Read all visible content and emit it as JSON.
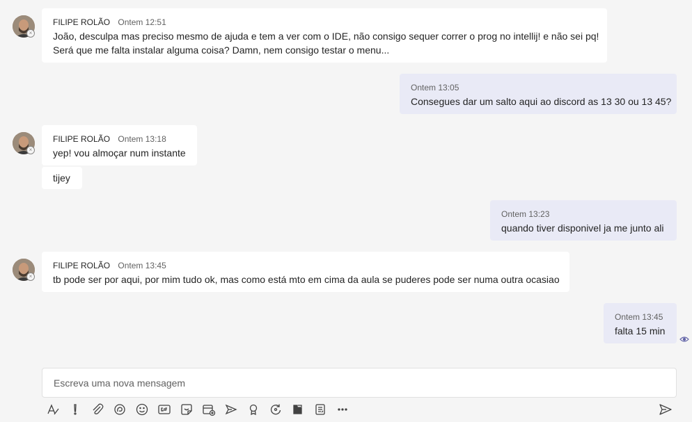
{
  "messages": [
    {
      "direction": "in",
      "sender": "FILIPE ROLÃO",
      "time": "Ontem 12:51",
      "lines": [
        "João, desculpa mas preciso mesmo de ajuda e tem a ver com o IDE, não consigo sequer correr o prog no intellij! e não sei pq!",
        "Será que me falta instalar alguma coisa? Damn, nem consigo testar o menu..."
      ]
    },
    {
      "direction": "out",
      "time": "Ontem 13:05",
      "lines": [
        "Consegues dar um salto aqui ao discord as 13 30 ou 13 45?"
      ]
    },
    {
      "direction": "in",
      "sender": "FILIPE ROLÃO",
      "time": "Ontem 13:18",
      "lines": [
        "yep! vou almoçar num instante"
      ]
    },
    {
      "direction": "in",
      "continuation": true,
      "lines": [
        "tijey"
      ]
    },
    {
      "direction": "out",
      "time": "Ontem 13:23",
      "lines": [
        "quando tiver disponivel ja me junto ali"
      ]
    },
    {
      "direction": "in",
      "sender": "FILIPE ROLÃO",
      "time": "Ontem 13:45",
      "lines": [
        "tb pode ser por aqui, por mim tudo ok, mas como está mto em cima da aula se puderes pode ser numa outra ocasiao"
      ]
    },
    {
      "direction": "out",
      "time": "Ontem 13:45",
      "lines": [
        "falta 15 min"
      ]
    }
  ],
  "composer": {
    "placeholder": "Escreva uma nova mensagem"
  },
  "toolbar": {
    "icons": [
      "format-icon",
      "important-icon",
      "attach-icon",
      "loop-icon",
      "emoji-icon",
      "gif-icon",
      "sticker-icon",
      "schedule-meeting-icon",
      "stream-icon",
      "praise-icon",
      "updates-icon",
      "app-icon",
      "forms-icon",
      "more-options-icon"
    ]
  },
  "colors": {
    "incoming_bg": "#ffffff",
    "outgoing_bg": "#e9eaf6",
    "page_bg": "#f5f5f5",
    "accent": "#6264a7"
  }
}
